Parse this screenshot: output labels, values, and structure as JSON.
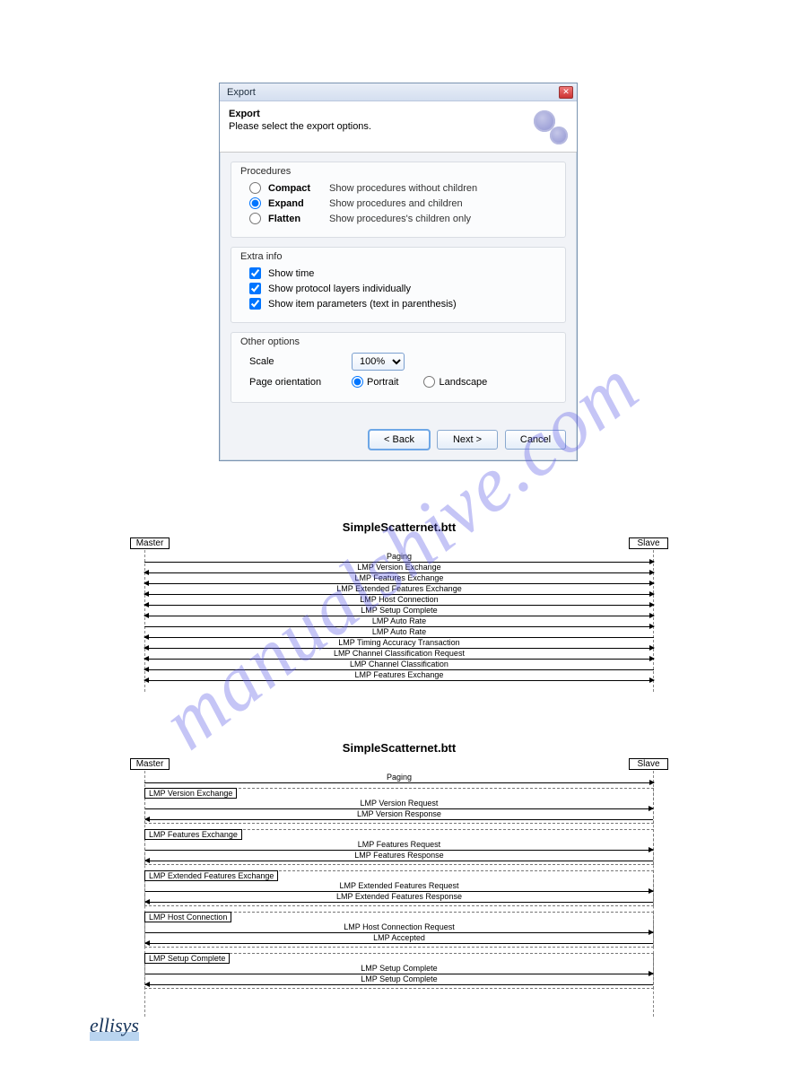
{
  "dialog": {
    "title": "Export",
    "header_title": "Export",
    "header_sub": "Please select the export options.",
    "procedures": {
      "legend": "Procedures",
      "options": [
        {
          "value": "compact",
          "label": "Compact",
          "desc": "Show procedures without children",
          "checked": false
        },
        {
          "value": "expand",
          "label": "Expand",
          "desc": "Show procedures and children",
          "checked": true
        },
        {
          "value": "flatten",
          "label": "Flatten",
          "desc": "Show procedures's children only",
          "checked": false
        }
      ]
    },
    "extra": {
      "legend": "Extra info",
      "items": [
        {
          "label": "Show time",
          "checked": true
        },
        {
          "label": "Show protocol layers individually",
          "checked": true
        },
        {
          "label": "Show item parameters (text in parenthesis)",
          "checked": true
        }
      ]
    },
    "other": {
      "legend": "Other options",
      "scale_key": "Scale",
      "scale_value": "100%",
      "orient_key": "Page orientation",
      "orient_portrait": "Portrait",
      "orient_landscape": "Landscape",
      "portrait_checked": true,
      "landscape_checked": false
    },
    "buttons": {
      "back": "< Back",
      "next": "Next >",
      "cancel": "Cancel"
    }
  },
  "msc1": {
    "title": "SimpleScatternet.btt",
    "left": "Master",
    "right": "Slave",
    "messages": [
      {
        "label": "Paging",
        "dir": "lr"
      },
      {
        "label": "LMP Version Exchange",
        "dir": "both"
      },
      {
        "label": "LMP Features Exchange",
        "dir": "both"
      },
      {
        "label": "LMP Extended Features Exchange",
        "dir": "both"
      },
      {
        "label": "LMP Host Connection",
        "dir": "both"
      },
      {
        "label": "LMP Setup Complete",
        "dir": "both"
      },
      {
        "label": "LMP Auto Rate",
        "dir": "lr"
      },
      {
        "label": "LMP Auto Rate",
        "dir": "rl"
      },
      {
        "label": "LMP Timing Accuracy Transaction",
        "dir": "both"
      },
      {
        "label": "LMP Channel Classification Request",
        "dir": "both"
      },
      {
        "label": "LMP Channel Classification",
        "dir": "rl"
      },
      {
        "label": "LMP Features Exchange",
        "dir": "both"
      }
    ]
  },
  "msc2": {
    "title": "SimpleScatternet.btt",
    "left": "Master",
    "right": "Slave",
    "preamble": {
      "label": "Paging",
      "dir": "lr"
    },
    "groups": [
      {
        "name": "LMP Version Exchange",
        "msgs": [
          {
            "label": "LMP Version Request",
            "dir": "lr"
          },
          {
            "label": "LMP Version Response",
            "dir": "rl"
          }
        ]
      },
      {
        "name": "LMP Features Exchange",
        "msgs": [
          {
            "label": "LMP Features Request",
            "dir": "lr"
          },
          {
            "label": "LMP Features Response",
            "dir": "rl"
          }
        ]
      },
      {
        "name": "LMP Extended Features Exchange",
        "msgs": [
          {
            "label": "LMP Extended Features Request",
            "dir": "lr"
          },
          {
            "label": "LMP Extended Features Response",
            "dir": "rl"
          }
        ]
      },
      {
        "name": "LMP Host Connection",
        "msgs": [
          {
            "label": "LMP Host Connection Request",
            "dir": "lr"
          },
          {
            "label": "LMP Accepted",
            "dir": "rl"
          }
        ]
      },
      {
        "name": "LMP Setup Complete",
        "msgs": [
          {
            "label": "LMP Setup Complete",
            "dir": "lr"
          },
          {
            "label": "LMP Setup Complete",
            "dir": "rl"
          }
        ]
      }
    ]
  },
  "watermark": "manualshive.com",
  "brand": "ellisys"
}
